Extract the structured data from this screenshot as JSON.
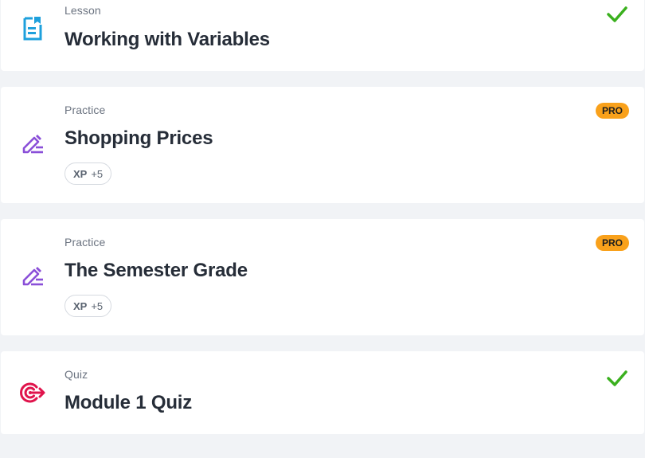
{
  "items": [
    {
      "type": "Lesson",
      "title": "Working with Variables",
      "icon": "lesson-document-icon",
      "completed": true
    },
    {
      "type": "Practice",
      "title": "Shopping Prices",
      "icon": "practice-pencil-icon",
      "pro": "PRO",
      "xp_label": "XP",
      "xp_value": "+5"
    },
    {
      "type": "Practice",
      "title": "The Semester Grade",
      "icon": "practice-pencil-icon",
      "pro": "PRO",
      "xp_label": "XP",
      "xp_value": "+5"
    },
    {
      "type": "Quiz",
      "title": "Module 1 Quiz",
      "icon": "quiz-target-icon",
      "completed": true
    }
  ],
  "colors": {
    "lesson_icon": "#1ea0dc",
    "practice_icon": "#8a4fd8",
    "quiz_icon": "#e0144c",
    "check": "#3ab01e",
    "pro_badge": "#f9a11b",
    "background": "#f1f3f6"
  }
}
